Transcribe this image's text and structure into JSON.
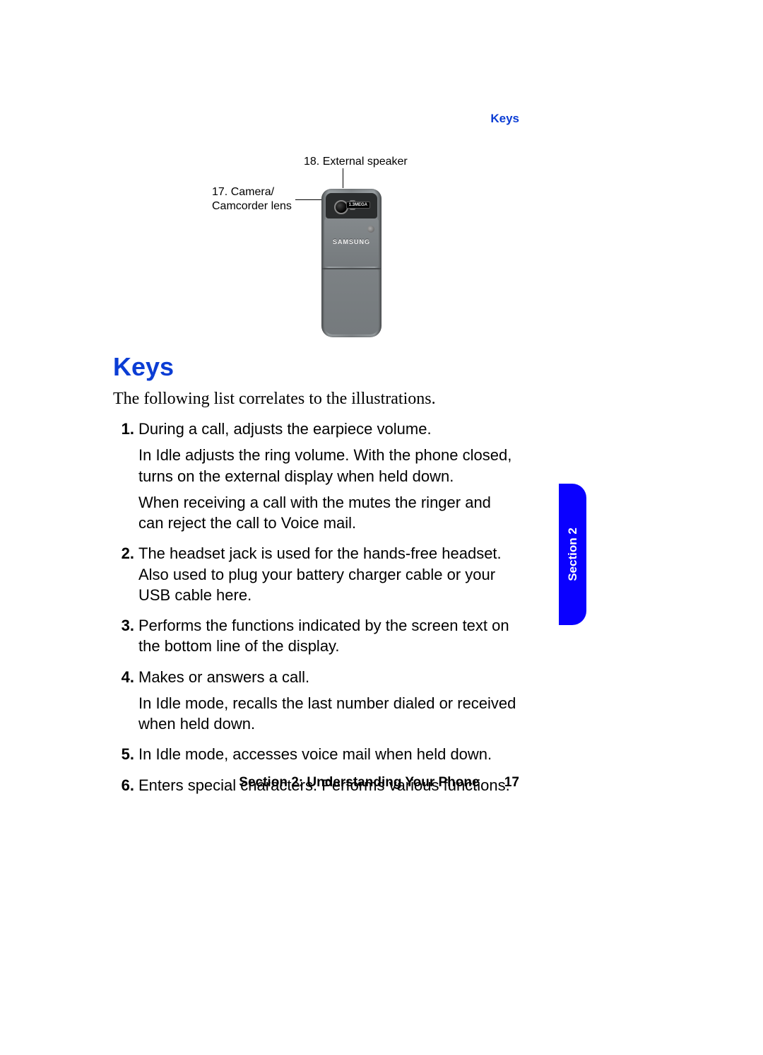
{
  "header": {
    "topic": "Keys"
  },
  "diagram": {
    "label17": "17. Camera/\nCamcorder lens",
    "label18": "18. External speaker",
    "brand": "SAMSUNG",
    "megapixel": "1.3MEGA"
  },
  "heading": "Keys",
  "intro": "The following list correlates to the illustrations.",
  "items": [
    {
      "num": "1.",
      "paras": [
        "During a call, adjusts the earpiece volume.",
        "In Idle adjusts the ring volume. With the phone closed, turns on the external display when held down.",
        "When receiving a call with the mutes the ringer and can reject the call to Voice mail."
      ]
    },
    {
      "num": "2.",
      "paras": [
        "The headset jack is used for the hands-free headset. Also used to plug your battery charger cable or your USB cable here."
      ]
    },
    {
      "num": "3.",
      "paras": [
        "Performs the functions indicated by the screen text on the bottom line of the display."
      ]
    },
    {
      "num": "4.",
      "paras": [
        "Makes or answers a call.",
        "In Idle mode, recalls the last number dialed or received when held down."
      ]
    },
    {
      "num": "5.",
      "paras": [
        "In Idle mode, accesses voice mail when held down."
      ]
    },
    {
      "num": "6.",
      "paras": [
        "Enters special characters. Performs various functions."
      ]
    }
  ],
  "sideTab": "Section 2",
  "footer": {
    "section": "Section 2: Understanding Your Phone",
    "page": "17"
  }
}
